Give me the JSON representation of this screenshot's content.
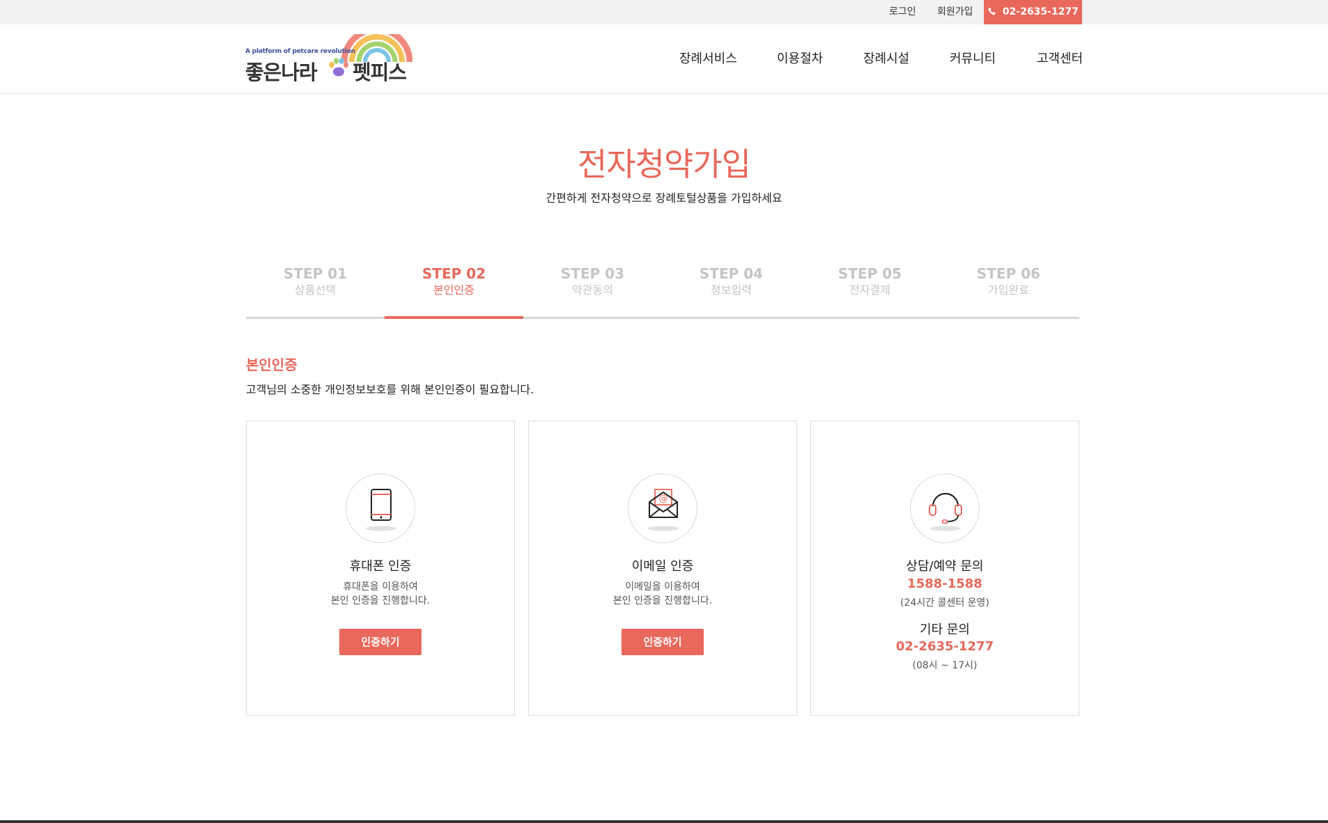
{
  "colors": {
    "accent": "#e8685b",
    "muted": "#c4c4c4",
    "text": "#222222"
  },
  "topbar": {
    "login": "로그인",
    "signup": "회원가입",
    "phone": "02-2635-1277",
    "phone_icon": "phone-icon"
  },
  "logo": {
    "tagline": "A platform of petcare revolution",
    "name_left": "좋은나라",
    "name_right": "펫피스"
  },
  "nav": [
    "장례서비스",
    "이용절차",
    "장례시설",
    "커뮤니티",
    "고객센터"
  ],
  "page": {
    "title": "전자청약가입",
    "subtitle": "간편하게 전자청약으로 장례토털상품을 가입하세요"
  },
  "steps": [
    {
      "num": "STEP 01",
      "label": "상품선택"
    },
    {
      "num": "STEP 02",
      "label": "본인인증"
    },
    {
      "num": "STEP 03",
      "label": "약관동의"
    },
    {
      "num": "STEP 04",
      "label": "정보입력"
    },
    {
      "num": "STEP 05",
      "label": "전자결제"
    },
    {
      "num": "STEP 06",
      "label": "가입완료"
    }
  ],
  "active_step": "STEP 02",
  "section": {
    "title": "본인인증",
    "desc": "고객님의 소중한 개인정보보호를 위해 본인인증이 필요합니다."
  },
  "cards": {
    "phone": {
      "icon": "mobile-phone-icon",
      "title": "휴대폰 인증",
      "desc1": "휴대폰을 이용하여",
      "desc2": "본인 인증을 진행합니다.",
      "button": "인증하기"
    },
    "email": {
      "icon": "email-envelope-icon",
      "title": "이메일 인증",
      "desc1": "이메일을 이용하여",
      "desc2": "본인 인증을 진행합니다.",
      "button": "인증하기"
    },
    "contact": {
      "icon": "headset-icon",
      "title1": "상담/예약 문의",
      "phone1": "1588-1588",
      "note1": "(24시간 콜센터 운영)",
      "title2": "기타 문의",
      "phone2": "02-2635-1277",
      "note2": "(08시 ~ 17시)"
    }
  }
}
